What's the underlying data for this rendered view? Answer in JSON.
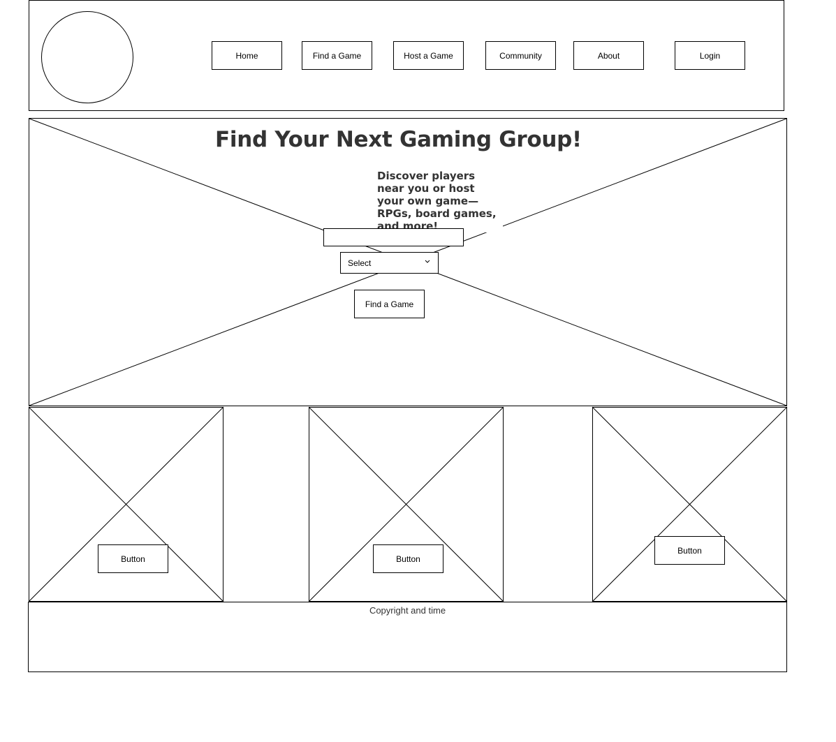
{
  "nav": {
    "items": [
      {
        "label": "Home"
      },
      {
        "label": "Find a Game"
      },
      {
        "label": "Host a Game"
      },
      {
        "label": "Community"
      },
      {
        "label": "About"
      }
    ],
    "login_label": "Login"
  },
  "hero": {
    "title": "Find Your Next Gaming Group!",
    "subtitle": "Discover players near you or host your own game—RPGs, board games, and more!",
    "search_value": "",
    "select_value": "Select",
    "cta_label": "Find a Game"
  },
  "cards": [
    {
      "button_label": "Button"
    },
    {
      "button_label": "Button"
    },
    {
      "button_label": "Button"
    }
  ],
  "footer": {
    "text": "Copyright and time"
  }
}
